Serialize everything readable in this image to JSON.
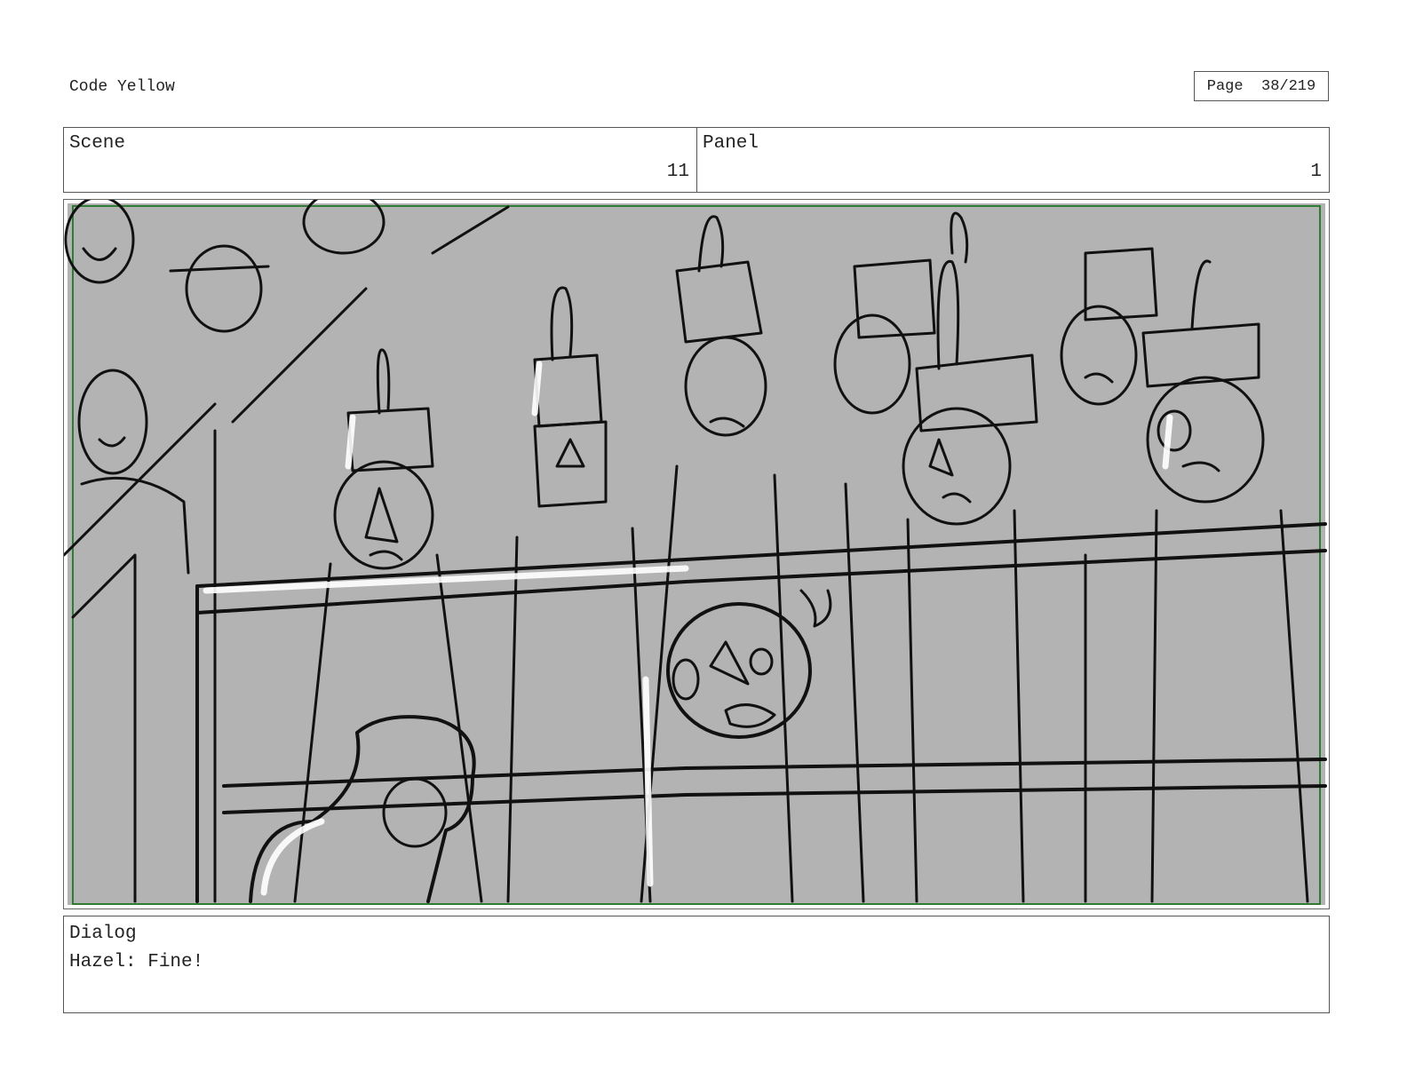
{
  "document": {
    "title": "Code Yellow",
    "page_label": "Page",
    "page_number": "38/219"
  },
  "header": {
    "scene_label": "Scene",
    "scene_value": "11",
    "panel_label": "Panel",
    "panel_value": "1"
  },
  "artwork": {
    "description_icon": "storyboard-sketch",
    "background_color": "#b3b3b3",
    "safe_frame_color": "#2e7d32"
  },
  "dialog": {
    "label": "Dialog",
    "text": "Hazel: Fine!"
  }
}
